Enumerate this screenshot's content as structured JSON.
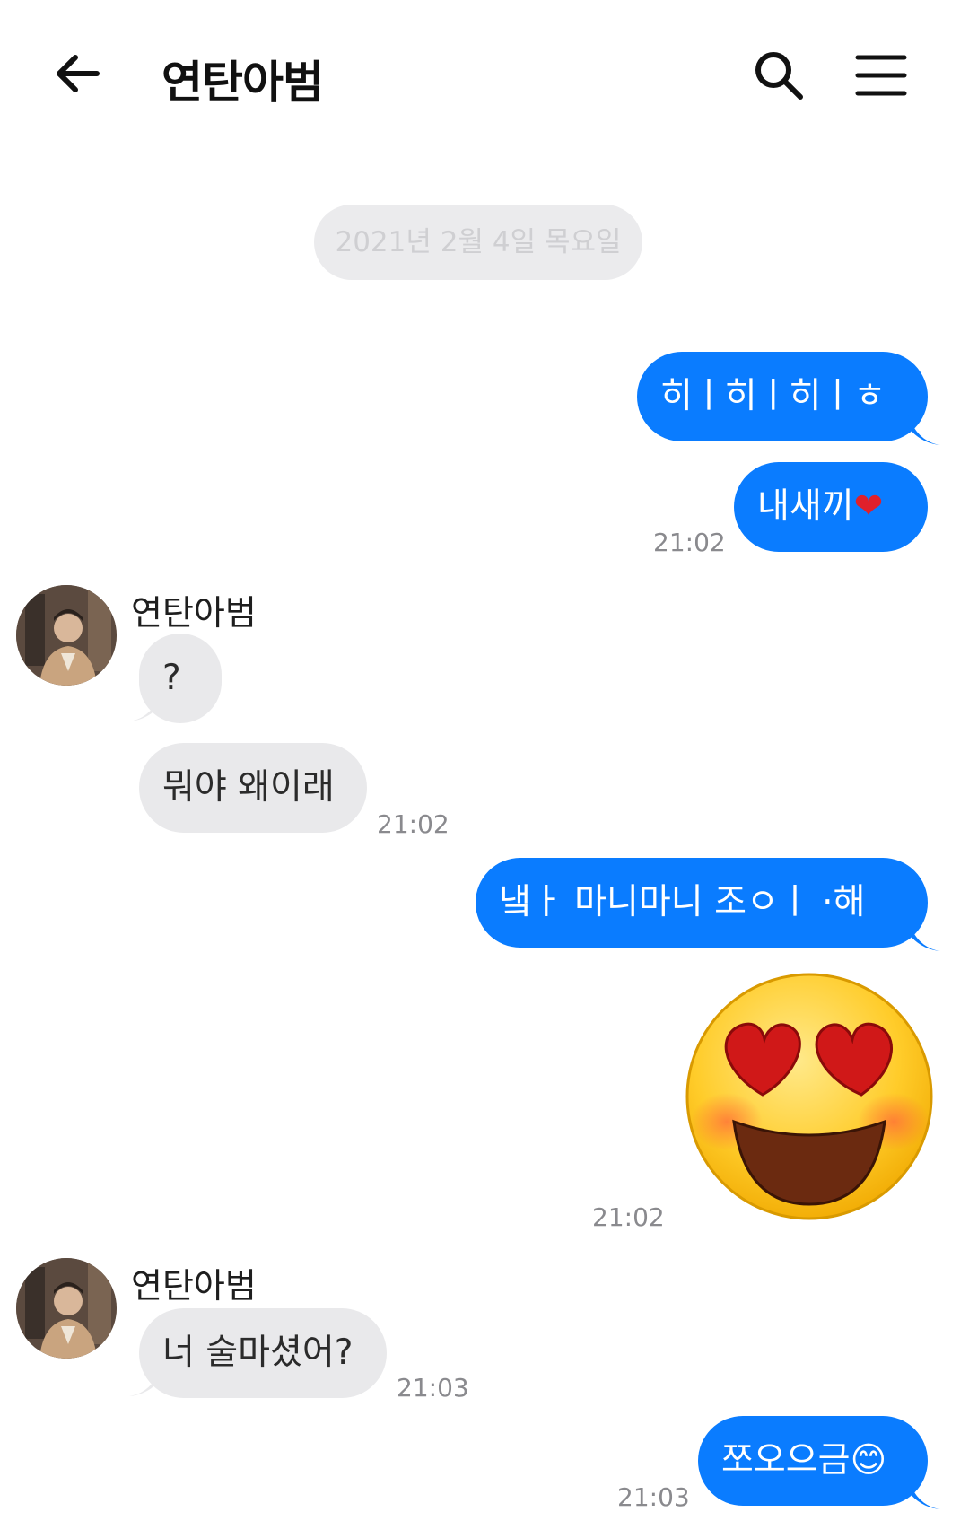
{
  "header": {
    "title": "연탄아범"
  },
  "date_separator": "2021년 2월 4일 목요일",
  "messages": {
    "m1": {
      "text": "히ㅣ히ㅣ히ㅣㅎ"
    },
    "m2": {
      "text": "내새끼",
      "emoji": "❤"
    },
    "t1": "21:02",
    "sender1": "연탄아범",
    "m3": {
      "text": "?"
    },
    "m4": {
      "text": "뭐야 왜이래"
    },
    "t2": "21:02",
    "m5": {
      "text": "냌ㅏ 마니마니 조ㅇㅣ ·해"
    },
    "t3": "21:02",
    "sender2": "연탄아범",
    "m6": {
      "text": "너 술마셨어?"
    },
    "t4": "21:03",
    "m7": {
      "text": "쪼오으금",
      "emoji": "😊"
    },
    "t5": "21:03"
  },
  "icons": {
    "back": "arrow-left-icon",
    "search": "search-icon",
    "menu": "hamburger-menu-icon",
    "big_emoji": "heart-eyes-smiley"
  },
  "colors": {
    "outgoing_bubble": "#0a7cff",
    "incoming_bubble": "#e9e9eb",
    "timestamp": "#8a8a8e"
  }
}
